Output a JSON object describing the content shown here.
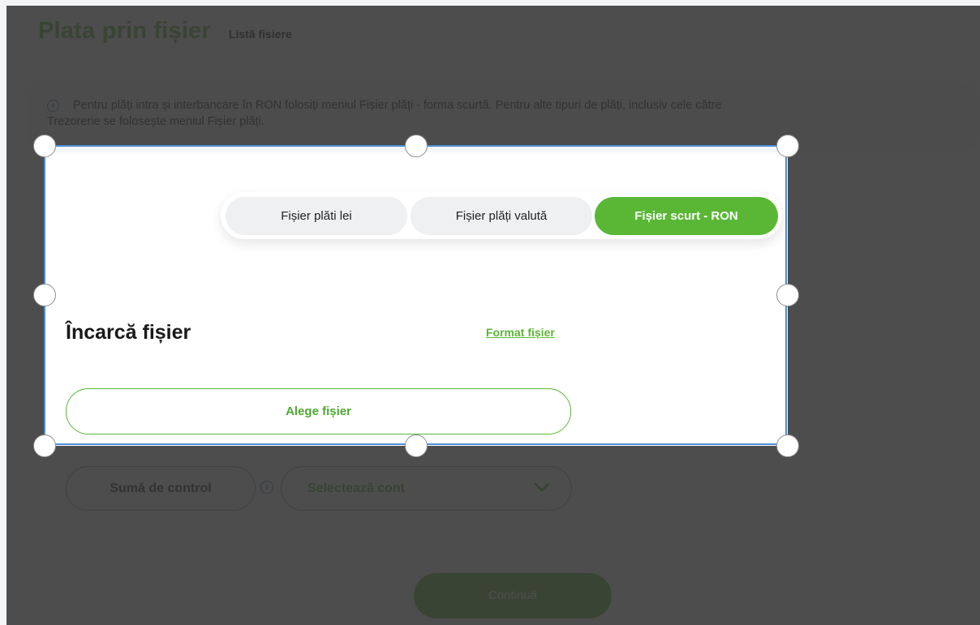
{
  "header": {
    "title": "Plata prin fișier",
    "subtitle": "Listă fisiere"
  },
  "info": {
    "line1": "Pentru plăți intra și interbancare în RON folosiți meniul Fișier plăți - forma scurtă. Pentru alte tipuri de plăți, inclusiv cele către",
    "line2": "Trezorerie se folosește meniul Fișier plăți.",
    "icon": "info-icon"
  },
  "tabs": [
    {
      "label": "Fișier plăti lei",
      "active": false
    },
    {
      "label": "Fișier plăți valută",
      "active": false
    },
    {
      "label": "Fișier scurt - RON",
      "active": true
    }
  ],
  "upload": {
    "title": "Încarcă fișier",
    "format_link": "Format fișier",
    "choose_button": "Alege fișier",
    "checksum_label": "Sumă de control",
    "account_select": "Selectează cont"
  },
  "actions": {
    "continue": "Continuă"
  },
  "colors": {
    "brand_green": "#5ab736",
    "info_blue": "#3a6fb0",
    "selection_blue": "#4d8ed6",
    "dim_overlay": "#343434"
  }
}
